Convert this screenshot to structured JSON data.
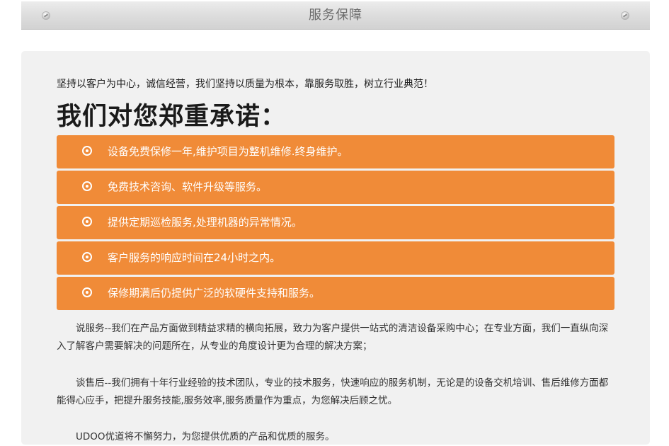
{
  "header": {
    "title": "服务保障"
  },
  "content": {
    "slogan": "坚持以客户为中心，诚信经营，我们坚持以质量为根本，靠服务取胜，树立行业典范！",
    "promise_title": "我们对您郑重承诺：",
    "promises": [
      "设备免费保修一年,维护项目为整机维修.终身维护。",
      "免费技术咨询、软件升级等服务。",
      "提供定期巡检服务,处理机器的异常情况。",
      "客户服务的响应时间在24小时之内。",
      "保修期满后仍提供广泛的软硬件支持和服务。"
    ],
    "paragraphs": [
      "说服务--我们在产品方面做到精益求精的横向拓展，致力为客户提供一站式的清洁设备采购中心；在专业方面，我们一直纵向深入了解客户需要解决的问题所在，从专业的角度设计更为合理的解决方案；",
      "谈售后--我们拥有十年行业经验的技术团队，专业的技术服务，快速响应的服务机制，无论是的设备交机培训、售后维修方面都能得心应手，把提升服务技能,服务效率,服务质量作为重点，为您解决后顾之忧。",
      "UDOO优道将不懈努力，为您提供优质的产品和优质的服务。"
    ]
  },
  "colors": {
    "accent": "#f08b38",
    "panel_bg": "#f1f1f1",
    "header_text": "#6b6b6b"
  },
  "icons": {
    "header_decor": "screw-icon",
    "promise_bullet": "circle-dot-icon"
  }
}
